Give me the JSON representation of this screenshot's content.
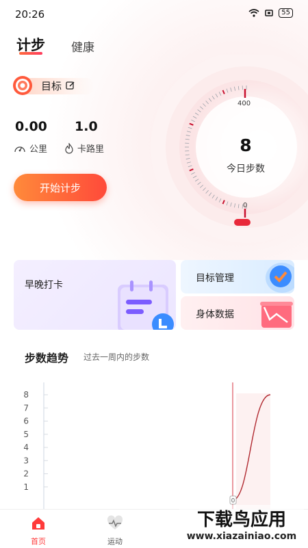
{
  "status_bar": {
    "time": "20:26",
    "battery": "55"
  },
  "tabs": [
    {
      "label": "计步",
      "active": true
    },
    {
      "label": "健康",
      "active": false
    }
  ],
  "goal": {
    "label": "目标"
  },
  "stats": [
    {
      "value": "0.00",
      "label": "公里",
      "icon": "speedometer-icon"
    },
    {
      "value": "1.0",
      "label": "卡路里",
      "icon": "flame-icon"
    }
  ],
  "start_button": "开始计步",
  "gauge": {
    "value": "8",
    "label": "今日步数",
    "max_label": "400",
    "min_label": "0",
    "progress": 0.02
  },
  "cards": {
    "checkin": "早晚打卡",
    "goal_mgmt": "目标管理",
    "body_data": "身体数据"
  },
  "trend": {
    "title": "步数趋势",
    "subtitle": "过去一周内的步数"
  },
  "chart_data": {
    "type": "line",
    "y_ticks": [
      "8",
      "7",
      "6",
      "5",
      "4",
      "3",
      "2",
      "1"
    ],
    "ylim": [
      0,
      8
    ],
    "values": [
      0,
      0,
      0,
      0,
      0,
      0,
      8
    ],
    "marker_label": "0"
  },
  "nav": [
    {
      "label": "首页",
      "icon": "home-icon",
      "active": true
    },
    {
      "label": "运动",
      "icon": "heartbeat-icon",
      "active": false
    }
  ],
  "watermark": {
    "title": "下载鸟应用",
    "url": "www.xiazainiao.com"
  },
  "colors": {
    "accent": "#ff4a3a",
    "gauge_tick": "#c8102e"
  }
}
